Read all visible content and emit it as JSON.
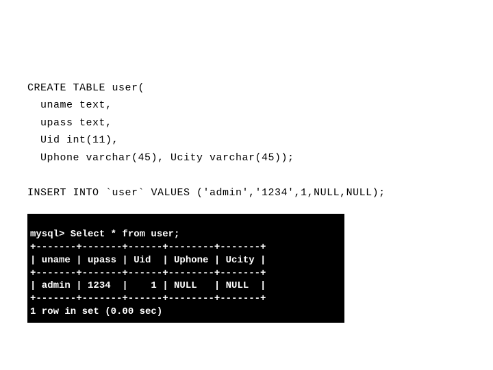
{
  "sql": {
    "line1": "CREATE TABLE user(",
    "line2": "  uname text,",
    "line3": "  upass text,",
    "line4": "  Uid int(11),",
    "line5": "  Uphone varchar(45), Ucity varchar(45));",
    "blank": "",
    "line6": "INSERT INTO `user` VALUES ('admin','1234',1,NULL,NULL);"
  },
  "terminal": {
    "prompt": "mysql> Select * from user;",
    "border": "+-------+-------+------+--------+-------+",
    "header": "| uname | upass | Uid  | Uphone | Ucity |",
    "row": "| admin | 1234  |    1 | NULL   | NULL  |",
    "footer": "1 row in set (0.00 sec)"
  },
  "chart_data": {
    "type": "table",
    "title": "user",
    "columns": [
      "uname",
      "upass",
      "Uid",
      "Uphone",
      "Ucity"
    ],
    "rows": [
      [
        "admin",
        "1234",
        1,
        "NULL",
        "NULL"
      ]
    ],
    "footer": "1 row in set (0.00 sec)"
  }
}
